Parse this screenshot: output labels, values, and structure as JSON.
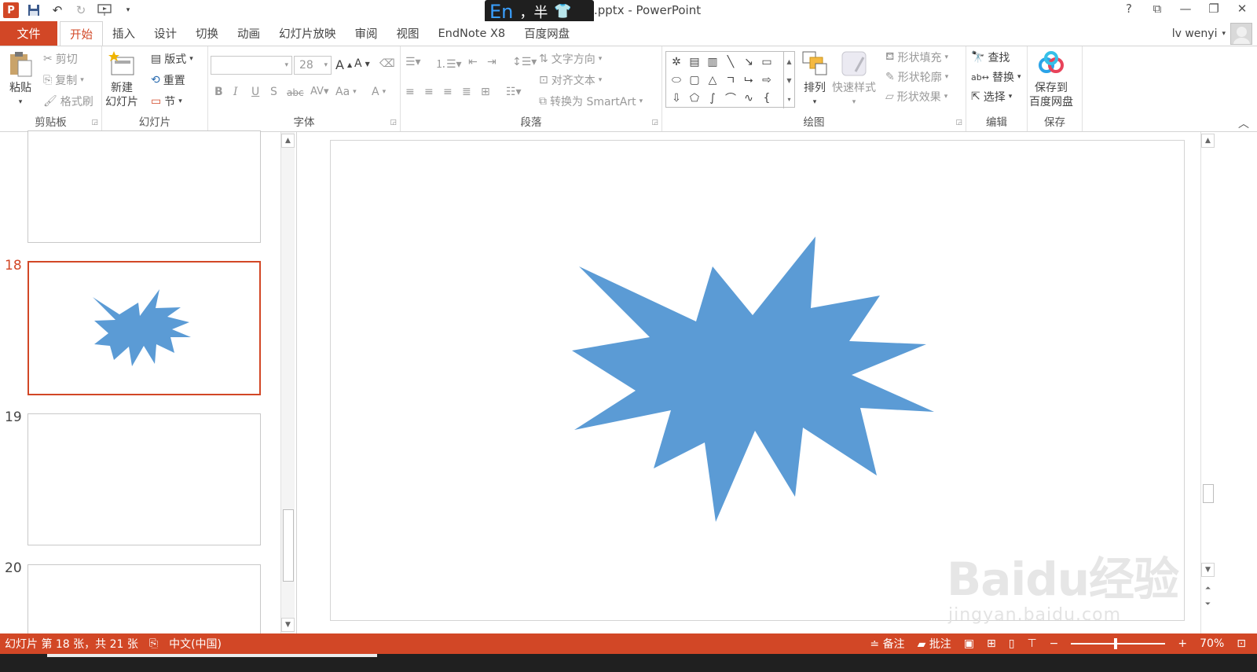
{
  "titlebar": {
    "window_title": ".pptx - PowerPoint",
    "ime": {
      "mode": "En",
      "punct": "，半"
    },
    "help": "?"
  },
  "tabs": {
    "file": "文件",
    "items": [
      "开始",
      "插入",
      "设计",
      "切换",
      "动画",
      "幻灯片放映",
      "审阅",
      "视图",
      "EndNote X8",
      "百度网盘"
    ],
    "active": "开始"
  },
  "user": {
    "name": "lv wenyi"
  },
  "ribbon": {
    "clipboard": {
      "label": "剪贴板",
      "paste": "粘贴",
      "cut": "剪切",
      "copy": "复制",
      "format_painter": "格式刷"
    },
    "slides": {
      "label": "幻灯片",
      "new_slide_1": "新建",
      "new_slide_2": "幻灯片",
      "layout": "版式",
      "reset": "重置",
      "section": "节"
    },
    "font": {
      "label": "字体",
      "font_name": "",
      "font_size": "28",
      "aa": "Aa"
    },
    "paragraph": {
      "label": "段落",
      "text_direction": "文字方向",
      "align_text": "对齐文本",
      "smartart": "转换为 SmartArt"
    },
    "drawing": {
      "label": "绘图",
      "arrange": "排列",
      "quick_styles": "快速样式",
      "shape_fill": "形状填充",
      "shape_outline": "形状轮廓",
      "shape_effects": "形状效果"
    },
    "editing": {
      "label": "编辑",
      "find": "查找",
      "replace": "替换",
      "select": "选择"
    },
    "save": {
      "label": "保存",
      "save_to_1": "保存到",
      "save_to_2": "百度网盘"
    }
  },
  "slides_panel": {
    "thumbnails": [
      {
        "number": "",
        "selected": false
      },
      {
        "number": "18",
        "selected": true
      },
      {
        "number": "19",
        "selected": false
      },
      {
        "number": "20",
        "selected": false
      }
    ]
  },
  "slide": {
    "shape": "explosion-star",
    "fill": "#5B9BD5"
  },
  "watermark": {
    "logo": "Baidu经验",
    "url": "jingyan.baidu.com"
  },
  "statusbar": {
    "slide_info": "幻灯片 第 18 张，共 21 张",
    "language": "中文(中国)",
    "notes": "备注",
    "comments": "批注",
    "zoom": "70%"
  },
  "colors": {
    "accent": "#D24726",
    "shape_fill": "#5B9BD5"
  }
}
